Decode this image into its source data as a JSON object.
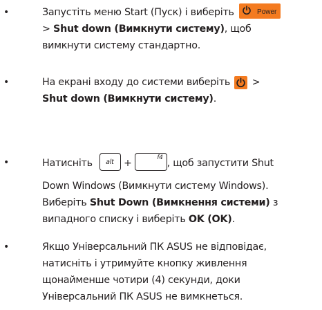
{
  "bullet": "•",
  "items": [
    {
      "lines": [
        {
          "a": "Запустіть меню Start (Пуск) і виберіть",
          "power_label": "Power"
        },
        {
          "a": "> ",
          "b": "Shut down (Вимкнути систему)",
          "c": ", щоб"
        },
        {
          "a": "вимкнути систему стандартно."
        }
      ]
    },
    {
      "lines": [
        {
          "a": "На екрані входу до системи виберіть",
          "c": " >"
        },
        {
          "b": "Shut down (Вимкнути систему)",
          "c": "."
        }
      ]
    },
    {
      "lines": [
        {
          "a": "Натисніть",
          "key1": "alt",
          "plus": "+",
          "key2": "f4",
          "c": ", щоб запустити Shut"
        },
        {
          "a": "Down Windows (Вимкнути систему Windows)."
        },
        {
          "a": "Виберіть ",
          "b": "Shut Down (Вимкнення системи)",
          "c": " з"
        },
        {
          "a": "випадного списку і виберіть ",
          "b": "OK (OK)",
          "c": "."
        }
      ]
    },
    {
      "lines": [
        {
          "a": "Якщо Універсальний ПК ASUS не відповідає,"
        },
        {
          "a": "натисніть і утримуйте кнопку живлення"
        },
        {
          "a": "щонайменше чотири (4) секунди, доки"
        },
        {
          "a": "Універсальний ПК ASUS не вимкнеться."
        }
      ]
    }
  ],
  "icons": {
    "power": "power-icon",
    "accent_color": "#f47b20",
    "text_color": "#231f20"
  }
}
